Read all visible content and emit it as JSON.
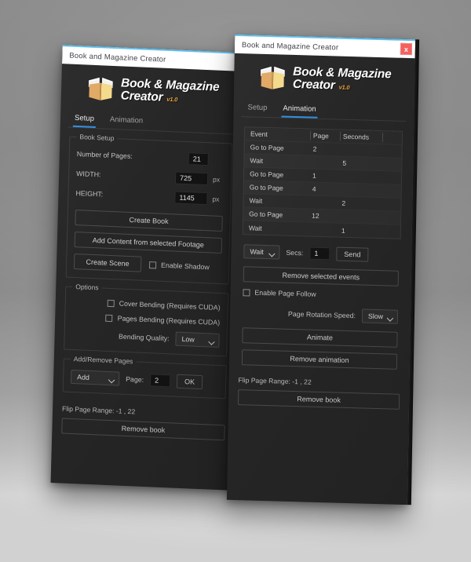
{
  "window": {
    "title": "Book and Magazine Creator",
    "close_label": "x",
    "accent_titlebar": "#5bc0f0",
    "close_color": "#f4615e"
  },
  "brand": {
    "line1": "Book & Magazine",
    "line2": "Creator",
    "version": "v1.0",
    "icon": "open-book-icon",
    "icon_color": "#e8b268",
    "version_color": "#e8a33d"
  },
  "tabs": {
    "setup": "Setup",
    "animation": "Animation",
    "active_color": "#2f8fe0"
  },
  "setup": {
    "book_setup": {
      "title": "Book Setup",
      "pages_label": "Number of Pages:",
      "pages_value": "21",
      "width_label": "WIDTH:",
      "width_value": "725",
      "width_unit": "px",
      "height_label": "HEIGHT:",
      "height_value": "1145",
      "height_unit": "px",
      "create_book": "Create Book",
      "add_content": "Add Content from selected Footage",
      "create_scene": "Create Scene",
      "enable_shadow": "Enable Shadow"
    },
    "options": {
      "title": "Options",
      "cover_bending": "Cover Bending (Requires CUDA)",
      "pages_bending": "Pages Bending (Requires CUDA)",
      "bending_quality_label": "Bending Quality:",
      "bending_quality_value": "Low"
    },
    "add_remove": {
      "title": "Add/Remove Pages",
      "action_value": "Add",
      "page_label": "Page:",
      "page_value": "2",
      "ok": "OK"
    }
  },
  "animation": {
    "table": {
      "headers": [
        "Event",
        "Page",
        "Seconds"
      ],
      "rows": [
        {
          "event": "Go to Page",
          "page": "2",
          "seconds": ""
        },
        {
          "event": "Wait",
          "page": "",
          "seconds": "5"
        },
        {
          "event": "Go to Page",
          "page": "1",
          "seconds": ""
        },
        {
          "event": "Go to Page",
          "page": "4",
          "seconds": ""
        },
        {
          "event": "Wait",
          "page": "",
          "seconds": "2"
        },
        {
          "event": "Go to Page",
          "page": "12",
          "seconds": ""
        },
        {
          "event": "Wait",
          "page": "",
          "seconds": "1"
        }
      ]
    },
    "event_type_value": "Wait",
    "secs_label": "Secs:",
    "secs_value": "1",
    "send": "Send",
    "remove_selected": "Remove selected events",
    "enable_page_follow": "Enable Page Follow",
    "rotation_speed_label": "Page Rotation Speed:",
    "rotation_speed_value": "Slow",
    "animate": "Animate",
    "remove_animation": "Remove animation"
  },
  "footer": {
    "flip_page_range": "Flip Page Range: -1 , 22",
    "remove_book": "Remove book"
  }
}
